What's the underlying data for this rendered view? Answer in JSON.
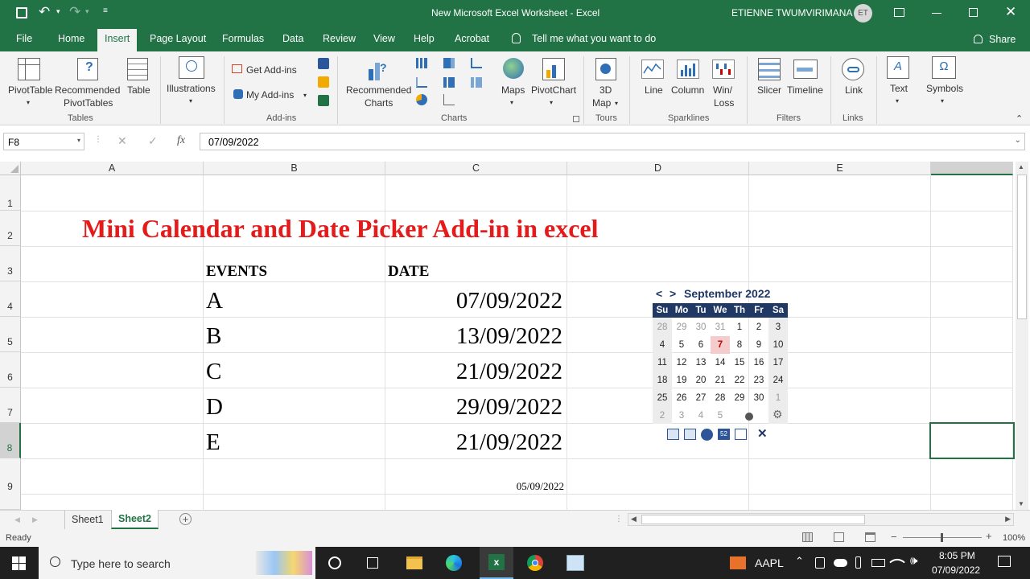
{
  "titlebar": {
    "doc_title": "New Microsoft Excel Worksheet  -  Excel",
    "user": "ETIENNE TWUMVIRIMANA",
    "avatar": "ET"
  },
  "tabs": [
    "File",
    "Home",
    "Insert",
    "Page Layout",
    "Formulas",
    "Data",
    "Review",
    "View",
    "Help",
    "Acrobat"
  ],
  "tell_me": "Tell me what you want to do",
  "share": "Share",
  "ribbon": {
    "pivottable": "PivotTable",
    "recommended_pivot_1": "Recommended",
    "recommended_pivot_2": "PivotTables",
    "table": "Table",
    "illustrations": "Illustrations",
    "get_addins": "Get Add-ins",
    "my_addins": "My Add-ins",
    "recommended_charts_1": "Recommended",
    "recommended_charts_2": "Charts",
    "maps": "Maps",
    "pivotchart": "PivotChart",
    "map3d_1": "3D",
    "map3d_2": "Map",
    "line": "Line",
    "column": "Column",
    "winloss_1": "Win/",
    "winloss_2": "Loss",
    "slicer": "Slicer",
    "timeline": "Timeline",
    "link": "Link",
    "text": "Text",
    "symbols": "Symbols",
    "groups": {
      "tables": "Tables",
      "addins": "Add-ins",
      "charts": "Charts",
      "tours": "Tours",
      "sparklines": "Sparklines",
      "filters": "Filters",
      "links": "Links"
    }
  },
  "formula": {
    "name_box": "F8",
    "value": "07/09/2022"
  },
  "columns": [
    "A",
    "B",
    "C",
    "D",
    "E"
  ],
  "rows": [
    "1",
    "2",
    "3",
    "4",
    "5",
    "6",
    "7",
    "8",
    "9"
  ],
  "sheet": {
    "title": "Mini Calendar and Date Picker Add-in in excel",
    "header_events": "EVENTS",
    "header_date": "DATE",
    "events": [
      "A",
      "B",
      "C",
      "D",
      "E"
    ],
    "dates": [
      "07/09/2022",
      "13/09/2022",
      "21/09/2022",
      "29/09/2022",
      "21/09/2022"
    ],
    "c9": "05/09/2022"
  },
  "calendar": {
    "prev": "<",
    "next": ">",
    "month_label": "September 2022",
    "day_headers": [
      "Su",
      "Mo",
      "Tu",
      "We",
      "Th",
      "Fr",
      "Sa"
    ],
    "weeks": [
      [
        "28",
        "29",
        "30",
        "31",
        "1",
        "2",
        "3"
      ],
      [
        "4",
        "5",
        "6",
        "7",
        "8",
        "9",
        "10"
      ],
      [
        "11",
        "12",
        "13",
        "14",
        "15",
        "16",
        "17"
      ],
      [
        "18",
        "19",
        "20",
        "21",
        "22",
        "23",
        "24"
      ],
      [
        "25",
        "26",
        "27",
        "28",
        "29",
        "30",
        "1"
      ],
      [
        "2",
        "3",
        "4",
        "5",
        "",
        "",
        ""
      ]
    ],
    "today": "7",
    "header_color": "#1f3864",
    "today_bg": "#f4cccc"
  },
  "sheet_tabs": [
    "Sheet1",
    "Sheet2"
  ],
  "active_sheet": "Sheet2",
  "status": {
    "ready": "Ready",
    "zoom": "100%"
  },
  "taskbar": {
    "search": "Type here to search",
    "ticker": "AAPL",
    "time": "8:05 PM",
    "date": "07/09/2022"
  },
  "colors": {
    "excel_green": "#217346",
    "title_red": "#e31b1b"
  }
}
